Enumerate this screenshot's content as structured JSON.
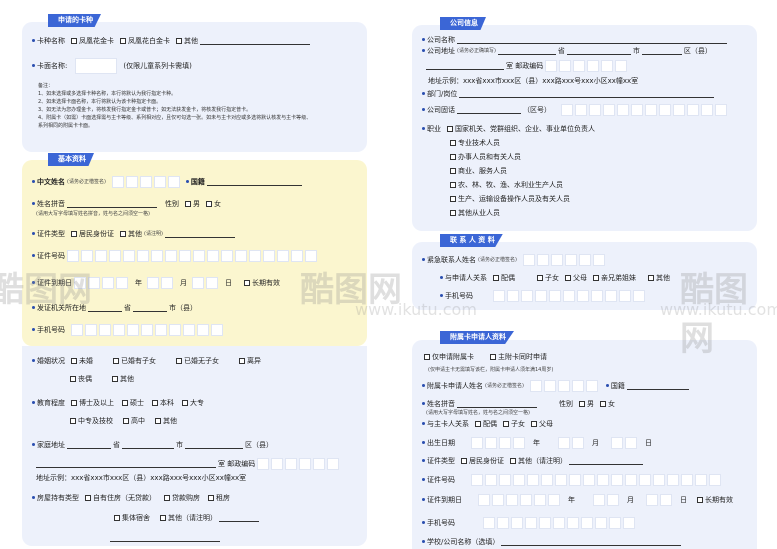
{
  "left": {
    "card_section": {
      "title": "申请的卡种",
      "card_name_label": "卡种名称",
      "options": [
        "凤凰花金卡",
        "凤凰花白金卡",
        "其他"
      ],
      "face_label": "卡面名称:",
      "face_note": "(仅限儿童系列卡需填)",
      "notes": [
        "备注：",
        "1、如未选择或多选择卡种名称，本行将默认为我行指定卡种。",
        "2、如未选择卡面名称，本行将默认为该卡种指定卡面。",
        "3、如无法为您办理金卡，将核发我行指定金卡或普卡；如无法获发金卡，将核发我行指定普卡。",
        "4、附属卡（如需）卡面选择需与主卡等级、系列相对应，且仅可勾选一张。如未与主卡对应或多选将默认核发与主卡等级、",
        "系列相同的附属卡卡面。"
      ]
    },
    "basic": {
      "title": "基本资料",
      "cn_name": "中文姓名",
      "cn_name_note": "(请务必正楷签名)",
      "nationality": "国籍",
      "pinyin": "姓名拼音",
      "pinyin_note": "(请用大写字母填写姓名拼音，姓与名之间须空一格)",
      "gender": "性别",
      "male": "男",
      "female": "女",
      "id_type": "证件类型",
      "id_resident": "居民身份证",
      "id_other": "其他",
      "id_other_note": "(请注明)",
      "id_number": "证件号码",
      "id_expiry": "证件到期日",
      "year": "年",
      "month": "月",
      "day": "日",
      "long_term": "长期有效",
      "issuer": "发证机关所在地",
      "province": "省",
      "city": "市（县）",
      "mobile": "手机号码"
    },
    "marital": {
      "label": "婚姻状况",
      "options": [
        "未婚",
        "已婚有子女",
        "已婚无子女",
        "离异"
      ],
      "options2": [
        "丧偶",
        "其他"
      ]
    },
    "education": {
      "label": "教育程度",
      "options": [
        "博士及以上",
        "硕士",
        "本科",
        "大专"
      ],
      "options2": [
        "中专及技校",
        "高中",
        "其他"
      ]
    },
    "home": {
      "label": "家庭地址",
      "province": "省",
      "city": "市",
      "district": "区（县）",
      "room": "室 邮政编码",
      "example": "地址示例：xxx省xxx市xxx区（县）xxx路xxx号xxx小区xx幢xx室"
    },
    "housing": {
      "label": "房屋持有类型",
      "options": [
        "自有住房（无贷款）",
        "贷款购房",
        "租房"
      ],
      "options2": [
        "集体宿舍",
        "其他（请注明）"
      ]
    }
  },
  "right": {
    "company": {
      "title": "公司信息",
      "name": "公司名称",
      "address": "公司地址",
      "address_note": "(请务必正确填写)",
      "province": "省",
      "city": "市",
      "district": "区（县）",
      "room": "室 邮政编码",
      "example": "地址示例：xxx省xxx市xxx区（县）xxx路xxx号xxx小区xx幢xx室",
      "dept": "部门/岗位",
      "phone": "公司固话",
      "area": "（区号）",
      "job": "职业",
      "job_options": [
        "国家机关、党群组织、企业、事业单位负责人",
        "专业技术人员",
        "办事人员和有关人员",
        "商业、服务人员",
        "农、林、牧、渔、水利业生产人员",
        "生产、运输设备操作人员及有关人员",
        "其他从业人员"
      ]
    },
    "contact": {
      "title": "联 系 人 资 料",
      "name": "紧急联系人姓名",
      "name_note": "(请务必正楷签名)",
      "relation": "与申请人关系",
      "rel_options": [
        "配偶",
        "子女",
        "父母",
        "亲兄弟姐妹",
        "其他"
      ],
      "mobile": "手机号码"
    },
    "supplementary": {
      "title": "附属卡申请人资料",
      "only_sup": "仅申请附属卡",
      "both": "主附卡同时申请",
      "note": "(仅申请主卡无需填写该栏，附属卡申请人须年满14周岁)",
      "name": "附属卡申请人姓名",
      "name_note": "(请务必正楷签名)",
      "nationality": "国籍",
      "pinyin": "姓名拼音",
      "pinyin_note": "(请用大写字母填写姓名，姓与名之间须空一格)",
      "gender": "性别",
      "male": "男",
      "female": "女",
      "relation": "与主卡人关系",
      "rel_options": [
        "配偶",
        "子女",
        "父母"
      ],
      "birth": "出生日期",
      "year": "年",
      "month": "月",
      "day": "日",
      "id_type": "证件类型",
      "id_resident": "居民身份证",
      "id_other": "其他（请注明）",
      "id_number": "证件号码",
      "id_expiry": "证件到期日",
      "long_term": "长期有效",
      "mobile": "手机号码",
      "school": "学校/公司名称（选填）"
    }
  },
  "watermark": {
    "brand": "酷图网",
    "url": "www.ikutu.com"
  },
  "colors": {
    "header": "#3b66d6",
    "panel": "#edf1fb",
    "yellow_panel": "#fbf6cf"
  }
}
